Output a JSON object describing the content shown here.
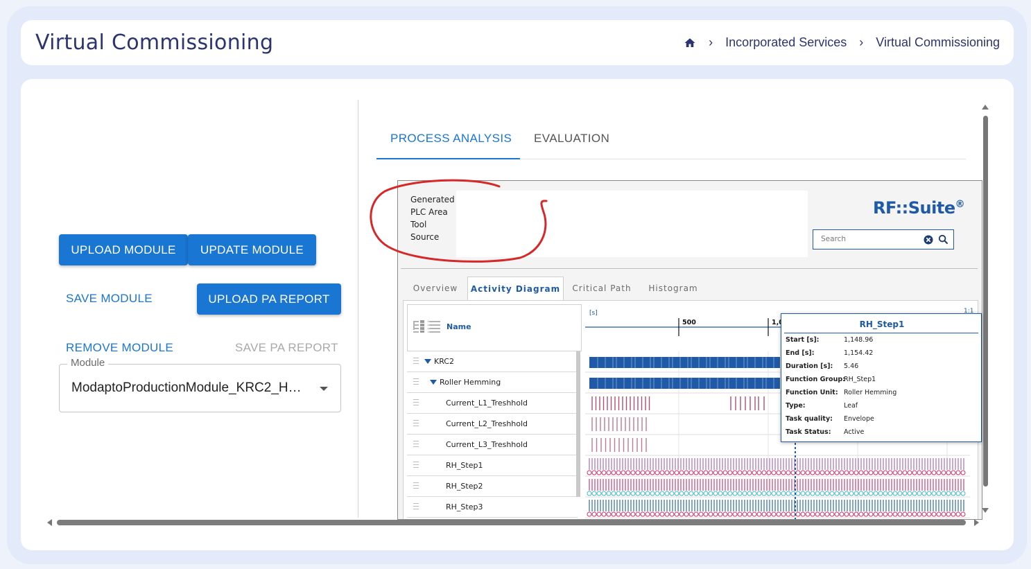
{
  "header": {
    "title": "Virtual Commissioning",
    "breadcrumb": [
      "Incorporated Services",
      "Virtual Commissioning"
    ],
    "home_icon": "home-icon"
  },
  "actions": {
    "upload_module": "UPLOAD MODULE",
    "update_module": "UPDATE MODULE",
    "save_module": "SAVE MODULE",
    "upload_pa_report": "UPLOAD PA REPORT",
    "remove_module": "REMOVE MODULE",
    "save_pa_report": "SAVE PA REPORT"
  },
  "module_select": {
    "label": "Module",
    "value": "ModaptoProductionModule_KRC2_H…"
  },
  "tabs": [
    {
      "label": "PROCESS ANALYSIS",
      "active": true
    },
    {
      "label": "EVALUATION",
      "active": false
    }
  ],
  "embedded": {
    "info_lines": [
      "Generated",
      "PLC Area",
      "Tool",
      "Source"
    ],
    "logo": "RF::Suite",
    "logo_mark": "®",
    "search_placeholder": "Search",
    "tabs": [
      "Overview",
      "Activity Diagram",
      "Critical Path",
      "Histogram"
    ],
    "active_tab": "Activity Diagram",
    "name_header": "Name",
    "rows": [
      {
        "label": "KRC2",
        "level": 0,
        "expandable": true
      },
      {
        "label": "Roller Hemming",
        "level": 1,
        "expandable": true
      },
      {
        "label": "Current_L1_Treshhold",
        "level": 2,
        "expandable": false
      },
      {
        "label": "Current_L2_Treshhold",
        "level": 2,
        "expandable": false
      },
      {
        "label": "Current_L3_Treshhold",
        "level": 2,
        "expandable": false
      },
      {
        "label": "RH_Step1",
        "level": 2,
        "expandable": false
      },
      {
        "label": "RH_Step2",
        "level": 2,
        "expandable": false
      },
      {
        "label": "RH_Step3",
        "level": 2,
        "expandable": false
      }
    ],
    "axis": {
      "unit_label": "[s]",
      "tick_500": "500",
      "tick_1000": "1,0",
      "zoom": "1:1"
    },
    "tooltip": {
      "title": "RH_Step1",
      "fields": [
        {
          "k": "Start [s]:",
          "v": "1,148.96"
        },
        {
          "k": "End [s]:",
          "v": "1,154.42"
        },
        {
          "k": "Duration [s]:",
          "v": "5.46"
        },
        {
          "k": "Function Group:",
          "v": "RH_Step1"
        },
        {
          "k": "Function Unit:",
          "v": "Roller Hemming"
        },
        {
          "k": "Type:",
          "v": "Leaf"
        },
        {
          "k": "Task quality:",
          "v": "Envelope"
        },
        {
          "k": "Task Status:",
          "v": "Active"
        }
      ]
    }
  },
  "colors": {
    "primary": "#1976d2",
    "title": "#2b3471",
    "rf_blue": "#1e5aa7",
    "annotation": "#d62828"
  }
}
